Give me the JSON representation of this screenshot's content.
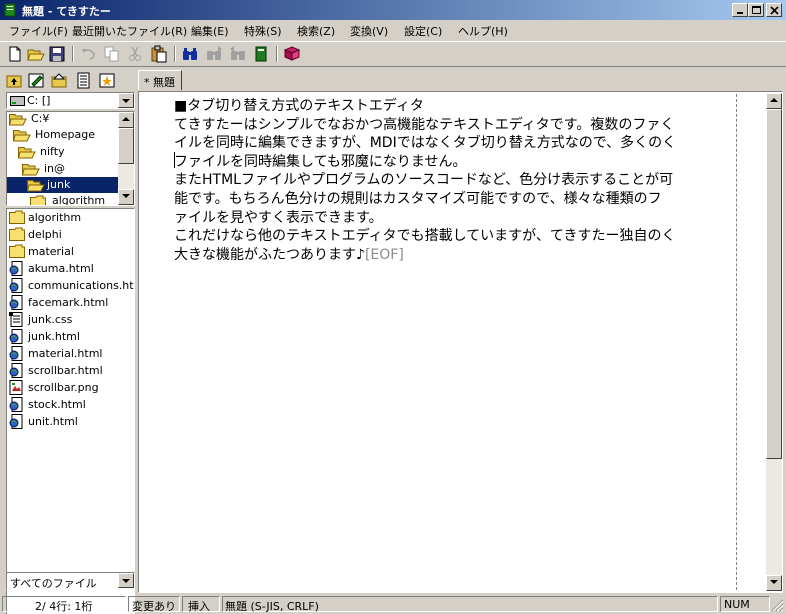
{
  "window": {
    "title": "無題 - てきすたー"
  },
  "menu": [
    "ファイル(F)",
    "最近開いたファイル(R)",
    "編集(E)",
    "特殊(S)",
    "検索(Z)",
    "変換(V)",
    "設定(C)",
    "ヘルプ(H)"
  ],
  "toolbar": {
    "icons": [
      "new-file-icon",
      "open-folder-icon",
      "save-icon",
      "undo-icon",
      "copy-icon",
      "cut-icon",
      "paste-icon",
      "find-icon",
      "find-next-icon",
      "find-prev-icon",
      "bookmark-icon",
      "help-book-icon"
    ]
  },
  "left_pane": {
    "drive": "C: []",
    "tree": [
      {
        "label": "C:¥",
        "icon": "open-folder-icon",
        "selected": false
      },
      {
        "label": "Homepage",
        "icon": "open-folder-icon",
        "selected": false
      },
      {
        "label": "nifty",
        "icon": "open-folder-icon",
        "selected": false
      },
      {
        "label": "in@",
        "icon": "open-folder-icon",
        "selected": false
      },
      {
        "label": "junk",
        "icon": "open-folder-icon",
        "selected": true
      },
      {
        "label": "algorithm",
        "icon": "folder-icon",
        "selected": false
      }
    ],
    "files": [
      {
        "name": "algorithm",
        "icon": "folder-icon"
      },
      {
        "name": "delphi",
        "icon": "folder-icon"
      },
      {
        "name": "material",
        "icon": "folder-icon"
      },
      {
        "name": "akuma.html",
        "icon": "html-file-icon"
      },
      {
        "name": "communications.html",
        "icon": "html-file-icon"
      },
      {
        "name": "facemark.html",
        "icon": "html-file-icon"
      },
      {
        "name": "junk.css",
        "icon": "text-file-icon"
      },
      {
        "name": "junk.html",
        "icon": "html-file-icon"
      },
      {
        "name": "material.html",
        "icon": "html-file-icon"
      },
      {
        "name": "scrollbar.html",
        "icon": "html-file-icon"
      },
      {
        "name": "scrollbar.png",
        "icon": "image-file-icon"
      },
      {
        "name": "stock.html",
        "icon": "html-file-icon"
      },
      {
        "name": "unit.html",
        "icon": "html-file-icon"
      }
    ],
    "filter": "すべてのファイル"
  },
  "tab": {
    "label": "* 無題"
  },
  "editor": {
    "lines": [
      "■タブ切り替え方式のテキストエディタ",
      "てきすたーはシンプルでなおかつ高機能なテキストエディタです。複数のファく",
      "イルを同時に編集できますが、MDIではなくタブ切り替え方式なので、多くのく",
      "ファイルを同時編集しても邪魔になりません。",
      "またHTMLファイルやプログラムのソースコードなど、色分け表示することが可",
      "能です。もちろん色分けの規則はカスタマイズ可能ですので、様々な種類のフ",
      "ァイルを見やすく表示できます。",
      "これだけなら他のテキストエディタでも搭載していますが、てきすたー独自のく",
      "大きな機能がふたつあります♪"
    ],
    "eof_marker": "[EOF]"
  },
  "status": {
    "position": "2/ 4行: 1桁",
    "modified": "変更あり",
    "insert_mode": "挿入",
    "file_info": "無題 (S-JIS, CRLF)",
    "num": "NUM"
  }
}
